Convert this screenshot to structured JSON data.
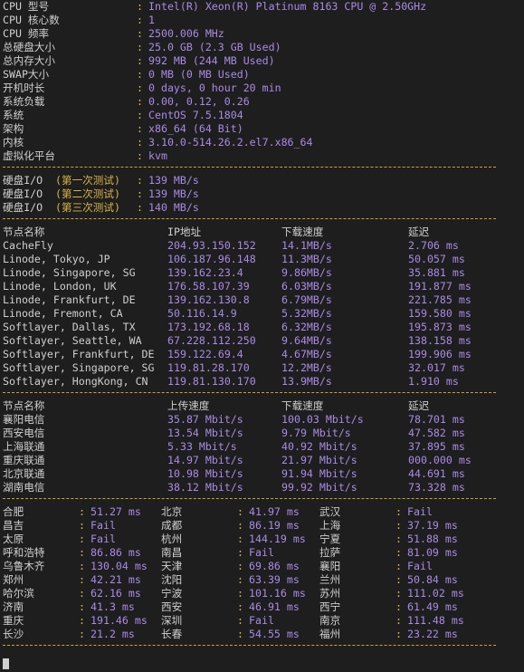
{
  "sysinfo": [
    {
      "label": "CPU 型号",
      "value": "Intel(R) Xeon(R) Platinum 8163 CPU @ 2.50GHz"
    },
    {
      "label": "CPU 核心数",
      "value": "1"
    },
    {
      "label": "CPU 频率",
      "value": "2500.006 MHz"
    },
    {
      "label": "总硬盘大小",
      "value": "25.0 GB (2.3 GB Used)"
    },
    {
      "label": "总内存大小",
      "value": "992 MB (244 MB Used)"
    },
    {
      "label": "SWAP大小",
      "value": "0 MB (0 MB Used)"
    },
    {
      "label": "开机时长",
      "value": "0 days, 0 hour 20 min"
    },
    {
      "label": "系统负载",
      "value": "0.00, 0.12, 0.26"
    },
    {
      "label": "系统",
      "value": "CentOS 7.5.1804"
    },
    {
      "label": "架构",
      "value": "x86_64 (64 Bit)"
    },
    {
      "label": "内核",
      "value": "3.10.0-514.26.2.el7.x86_64"
    },
    {
      "label": "虚拟化平台",
      "value": "kvm"
    }
  ],
  "disk_io": [
    {
      "label": "硬盘I/O",
      "test": "(第一次测试)",
      "value": "139 MB/s"
    },
    {
      "label": "硬盘I/O",
      "test": "(第二次测试)",
      "value": "139 MB/s"
    },
    {
      "label": "硬盘I/O",
      "test": "(第三次测试)",
      "value": "140 MB/s"
    }
  ],
  "speedtest": {
    "headers": [
      "节点名称",
      "IP地址",
      "下载速度",
      "延迟"
    ],
    "rows": [
      [
        "CacheFly",
        "204.93.150.152",
        "14.1MB/s",
        "2.706 ms"
      ],
      [
        "Linode, Tokyo, JP",
        "106.187.96.148",
        "11.3MB/s",
        "50.057 ms"
      ],
      [
        "Linode, Singapore, SG",
        "139.162.23.4",
        "9.86MB/s",
        "35.881 ms"
      ],
      [
        "Linode, London, UK",
        "176.58.107.39",
        "6.03MB/s",
        "191.877 ms"
      ],
      [
        "Linode, Frankfurt, DE",
        "139.162.130.8",
        "6.79MB/s",
        "221.785 ms"
      ],
      [
        "Linode, Fremont, CA",
        "50.116.14.9",
        "5.32MB/s",
        "159.580 ms"
      ],
      [
        "Softlayer, Dallas, TX",
        "173.192.68.18",
        "6.32MB/s",
        "195.873 ms"
      ],
      [
        "Softlayer, Seattle, WA",
        "67.228.112.250",
        "9.64MB/s",
        "138.158 ms"
      ],
      [
        "Softlayer, Frankfurt, DE",
        "159.122.69.4",
        "4.67MB/s",
        "199.906 ms"
      ],
      [
        "Softlayer, Singapore, SG",
        "119.81.28.170",
        "12.2MB/s",
        "32.017 ms"
      ],
      [
        "Softlayer, HongKong, CN",
        "119.81.130.170",
        "13.9MB/s",
        "1.910 ms"
      ]
    ]
  },
  "china_speed": {
    "headers": [
      "节点名称",
      "上传速度",
      "下载速度",
      "延迟"
    ],
    "rows": [
      [
        "襄阳电信",
        "35.87 Mbit/s",
        "100.03 Mbit/s",
        "78.701 ms"
      ],
      [
        "西安电信",
        "13.54 Mbit/s",
        "9.79 Mbit/s",
        "47.582 ms"
      ],
      [
        "上海联通",
        "5.33 Mbit/s",
        "40.92 Mbit/s",
        "37.895 ms"
      ],
      [
        "重庆联通",
        "14.97 Mbit/s",
        "21.97 Mbit/s",
        "000.000 ms"
      ],
      [
        "北京联通",
        "10.98 Mbit/s",
        "91.94 Mbit/s",
        "44.691 ms"
      ],
      [
        "湖南电信",
        "38.12 Mbit/s",
        "99.92 Mbit/s",
        "73.328 ms"
      ]
    ]
  },
  "ping": {
    "rows": [
      [
        [
          "合肥",
          "51.27 ms"
        ],
        [
          "北京",
          "41.97 ms"
        ],
        [
          "武汉",
          "Fail"
        ]
      ],
      [
        [
          "昌吉",
          "Fail"
        ],
        [
          "成都",
          "86.19 ms"
        ],
        [
          "上海",
          "37.19 ms"
        ]
      ],
      [
        [
          "太原",
          "Fail"
        ],
        [
          "杭州",
          "144.19 ms"
        ],
        [
          "宁夏",
          "51.88 ms"
        ]
      ],
      [
        [
          "呼和浩特",
          "86.86 ms"
        ],
        [
          "南昌",
          "Fail"
        ],
        [
          "拉萨",
          "81.09 ms"
        ]
      ],
      [
        [
          "乌鲁木齐",
          "130.04 ms"
        ],
        [
          "天津",
          "69.86 ms"
        ],
        [
          "襄阳",
          "Fail"
        ]
      ],
      [
        [
          "郑州",
          "42.21 ms"
        ],
        [
          "沈阳",
          "63.39 ms"
        ],
        [
          "兰州",
          "50.84 ms"
        ]
      ],
      [
        [
          "哈尔滨",
          "62.16 ms"
        ],
        [
          "宁波",
          "101.16 ms"
        ],
        [
          "苏州",
          "111.02 ms"
        ]
      ],
      [
        [
          "济南",
          "41.3 ms"
        ],
        [
          "西安",
          "46.91 ms"
        ],
        [
          "西宁",
          "61.49 ms"
        ]
      ],
      [
        [
          "重庆",
          "191.46 ms"
        ],
        [
          "深圳",
          "Fail"
        ],
        [
          "南京",
          "111.48 ms"
        ]
      ],
      [
        [
          "长沙",
          "21.2 ms"
        ],
        [
          "长春",
          "54.55 ms"
        ],
        [
          "福州",
          "23.22 ms"
        ]
      ]
    ]
  },
  "colors": {
    "background": "#1e1e1e",
    "text": "#cfcfcf",
    "value": "#a98be6",
    "accent": "#d9b24a"
  }
}
